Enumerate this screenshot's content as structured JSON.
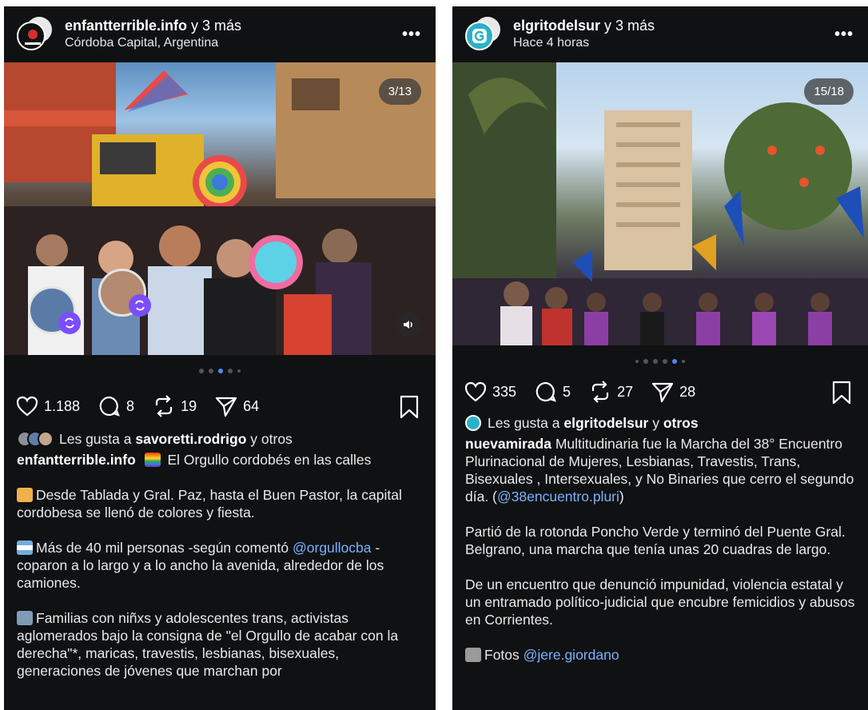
{
  "left": {
    "header": {
      "username": "enfantterrible.info",
      "coauthors": " y 3 más",
      "location": "Córdoba Capital, Argentina",
      "more": "•••"
    },
    "media": {
      "counter": "3/13"
    },
    "stats": {
      "likes": "1.188",
      "comments": "8",
      "reposts": "19",
      "shares": "64"
    },
    "liked_by": {
      "prefix": "Les gusta a ",
      "user": "savoretti.rodrigo",
      "suffix": " y otros"
    },
    "caption": {
      "user": "enfantterrible.info",
      "headline": " El Orgullo cordobés en las calles",
      "p1": "Desde Tablada y Gral. Paz, hasta el Buen Pastor, la capital cordobesa se llenó de colores y fiesta.",
      "p2_a": "Más de 40 mil personas -según comentó ",
      "p2_mention": "@orgullocba",
      "p2_b": " - coparon a lo largo y a lo ancho la avenida, alrededor de los camiones.",
      "p3": "Familias con niñxs y adolescentes trans, activistas aglomerados bajo la consigna de \"el Orgullo de acabar con la derecha\"*, maricas, travestis, lesbianas, bisexuales, generaciones de jóvenes que marchan por"
    }
  },
  "right": {
    "header": {
      "username": "elgritodelsur",
      "coauthors": " y 3 más",
      "time": "Hace 4 horas",
      "more": "•••"
    },
    "media": {
      "counter": "15/18"
    },
    "stats": {
      "likes": "335",
      "comments": "5",
      "reposts": "27",
      "shares": "28"
    },
    "liked_by": {
      "prefix": "Les gusta a ",
      "user": "elgritodelsur",
      "middle": " y ",
      "others": "otros"
    },
    "caption": {
      "user": "nuevamirada",
      "p1_a": " Multitudinaria fue la Marcha del 38° Encuentro Plurinacional de Mujeres, Lesbianas, Travestis, Trans, Bisexuales , Intersexuales, y No Binaries que cerro el segundo día. (",
      "p1_mention": "@38encuentro.pluri",
      "p1_b": ")",
      "p2": "Partió de la rotonda Poncho Verde y terminó del Puente Gral. Belgrano, una marcha que tenía unas 20 cuadras de largo.",
      "p3": "De un encuentro que denunció impunidad, violencia estatal y un entramado político-judicial que encubre femicidios y abusos en Corrientes.",
      "p4_a": "Fotos ",
      "p4_mention": "@jere.giordano"
    }
  },
  "colors": {
    "background": "#101113",
    "link": "#7ab2ff",
    "active_dot": "#4a8cff",
    "repost_badge": "#7b4dff"
  }
}
